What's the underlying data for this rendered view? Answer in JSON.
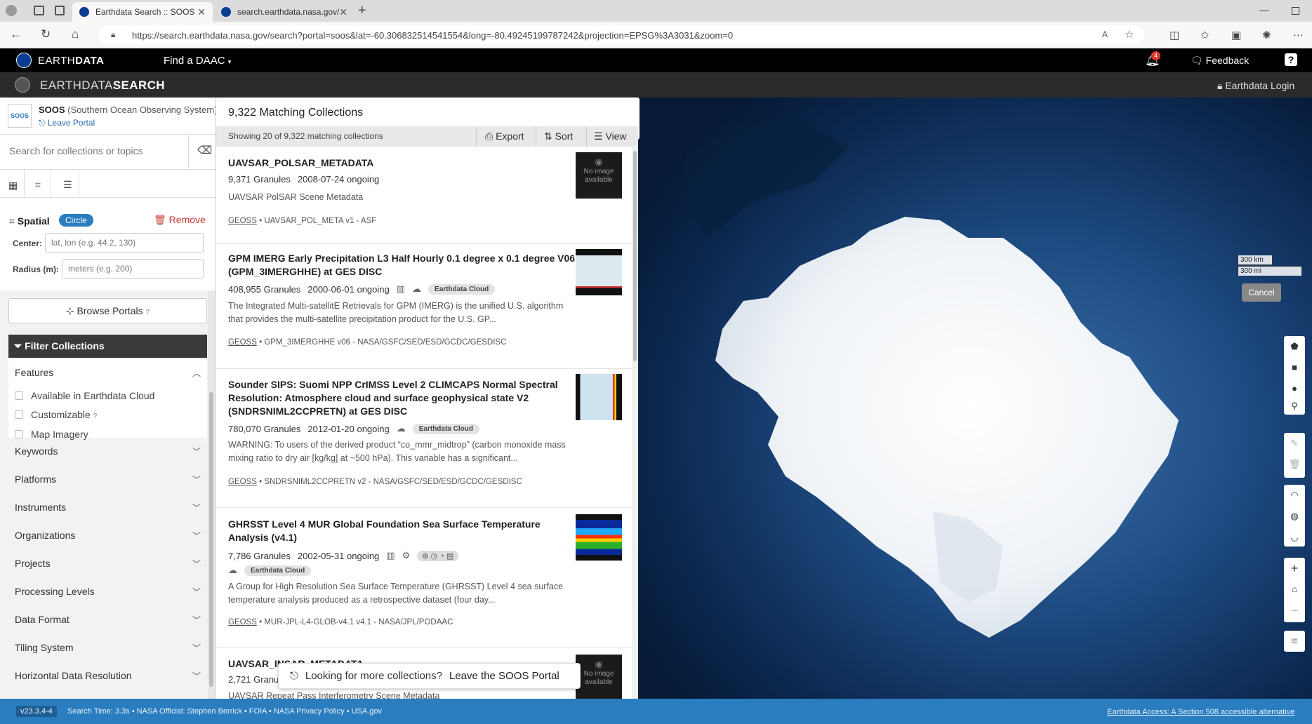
{
  "browser": {
    "tabs": [
      {
        "title": "Earthdata Search :: SOOS Portal |"
      },
      {
        "title": "search.earthdata.nasa.gov/search"
      }
    ],
    "url": "https://search.earthdata.nasa.gov/search?portal=soos&lat=-60.306832514541554&long=-80.49245199787242&projection=EPSG%3A3031&zoom=0"
  },
  "topnav": {
    "brand_prefix": "EARTH",
    "brand_suffix": "DATA",
    "find_daac": "Find a DAAC",
    "notification_count": "4",
    "feedback": "Feedback",
    "help": "?"
  },
  "searchbar": {
    "brand_prefix": "EARTHDATA",
    "brand_suffix": "SEARCH",
    "login": "Earthdata Login"
  },
  "portal": {
    "logo_text": "SOOS",
    "name": "SOOS",
    "full_name": "(Southern Ocean Observing System)",
    "leave": "Leave Portal"
  },
  "search": {
    "placeholder": "Search for collections or topics"
  },
  "spatial": {
    "label": "Spatial",
    "type_badge": "Circle",
    "remove": "Remove",
    "center_label": "Center:",
    "center_placeholder": "lat, lon (e.g. 44.2, 130)",
    "radius_label": "Radius (m):",
    "radius_placeholder": "meters (e.g. 200)"
  },
  "browse_portals": "Browse Portals",
  "filters": {
    "header": "Filter Collections",
    "features_title": "Features",
    "features": [
      {
        "label": "Available in Earthdata Cloud"
      },
      {
        "label": "Customizable"
      },
      {
        "label": "Map Imagery"
      }
    ],
    "facets": [
      "Keywords",
      "Platforms",
      "Instruments",
      "Organizations",
      "Projects",
      "Processing Levels",
      "Data Format",
      "Tiling System",
      "Horizontal Data Resolution"
    ]
  },
  "results": {
    "heading": "9,322 Matching Collections",
    "showing": "Showing 20 of 9,322 matching collections",
    "export": "Export",
    "sort": "Sort",
    "view": "View",
    "items": [
      {
        "title": "UAVSAR_POLSAR_METADATA",
        "granules": "9,371 Granules",
        "dates": "2008-07-24 ongoing",
        "description": "UAVSAR PolSAR Scene Metadata",
        "geoss": "GEOSS",
        "footer": "UAVSAR_POL_META v1 - ASF",
        "thumb": "No image available"
      },
      {
        "title": "GPM IMERG Early Precipitation L3 Half Hourly 0.1 degree x 0.1 degree V06 (GPM_3IMERGHHE) at GES DISC",
        "granules": "408,955 Granules",
        "dates": "2000-06-01 ongoing",
        "badge": "Earthdata Cloud",
        "description": "The Integrated Multi-satellitE Retrievals for GPM (IMERG) is the unified U.S. algorithm that provides the multi-satellite precipitation product for the U.S. GP...",
        "geoss": "GEOSS",
        "footer": "GPM_3IMERGHHE v06 - NASA/GSFC/SED/ESD/GCDC/GESDISC"
      },
      {
        "title": "Sounder SIPS: Suomi NPP CrIMSS Level 2 CLIMCAPS Normal Spectral Resolution: Atmosphere cloud and surface geophysical state V2 (SNDRSNIML2CCPRETN) at GES DISC",
        "granules": "780,070 Granules",
        "dates": "2012-01-20 ongoing",
        "badge": "Earthdata Cloud",
        "description": "WARNING: To users of the derived product “co_mmr_midtrop” (carbon monoxide mass mixing ratio to dry air [kg/kg] at ~500 hPa). This variable has a significant...",
        "geoss": "GEOSS",
        "footer": "SNDRSNIML2CCPRETN v2 - NASA/GSFC/SED/ESD/GCDC/GESDISC"
      },
      {
        "title": "GHRSST Level 4 MUR Global Foundation Sea Surface Temperature Analysis (v4.1)",
        "granules": "7,786 Granules",
        "dates": "2002-05-31 ongoing",
        "badge": "Earthdata Cloud",
        "description": "A Group for High Resolution Sea Surface Temperature (GHRSST) Level 4 sea surface temperature analysis produced as a retrospective dataset (four day...",
        "geoss": "GEOSS",
        "footer": "MUR-JPL-L4-GLOB-v4.1 v4.1 - NASA/JPL/PODAAC"
      },
      {
        "title": "UAVSAR_INSAR_METADATA",
        "granules": "2,721 Granu",
        "description": "UAVSAR Repeat Pass Interferometry Scene Metadata",
        "thumb": "No image available"
      }
    ],
    "toast_question": "Looking for more collections?",
    "toast_action": "Leave the SOOS Portal"
  },
  "map": {
    "scale_km": "300 km",
    "scale_mi": "300 mi",
    "cancel": "Cancel"
  },
  "footer": {
    "version": "v23.3.4-4",
    "search_time": "Search Time: 3.3s",
    "official": "NASA Official: Stephen Berrick",
    "foia": "FOIA",
    "privacy": "NASA Privacy Policy",
    "usagov": "USA.gov",
    "access": "Earthdata Access: A Section 508 accessible alternative"
  }
}
